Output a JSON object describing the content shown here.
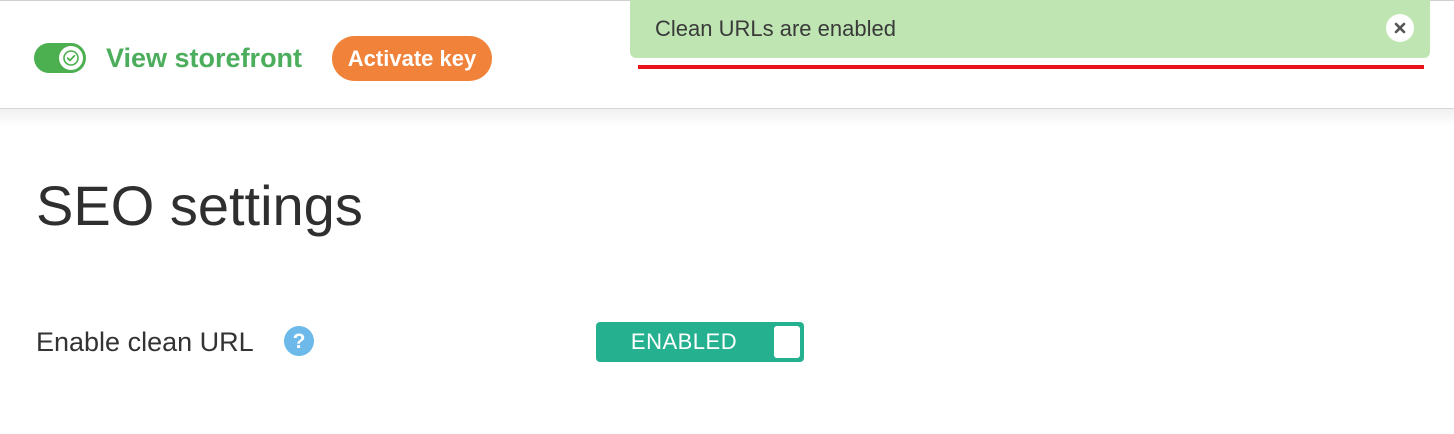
{
  "header": {
    "storefront_toggle": {
      "state": "on",
      "icon": "check-icon"
    },
    "view_storefront_label": "View storefront",
    "activate_key_label": "Activate key"
  },
  "notification": {
    "message": "Clean URLs are enabled",
    "close_icon": "close-icon",
    "colors": {
      "background": "#bfe6b2",
      "underline": "#e8141a"
    }
  },
  "main": {
    "title": "SEO settings",
    "settings": [
      {
        "label": "Enable clean URL",
        "help_icon": "question-mark-icon",
        "switch_label": "ENABLED",
        "switch_state": "on"
      }
    ]
  },
  "colors": {
    "accent_green": "#4cae5d",
    "activate_orange": "#f0823a",
    "switch_teal": "#25b190",
    "help_blue": "#6cb9ea"
  }
}
